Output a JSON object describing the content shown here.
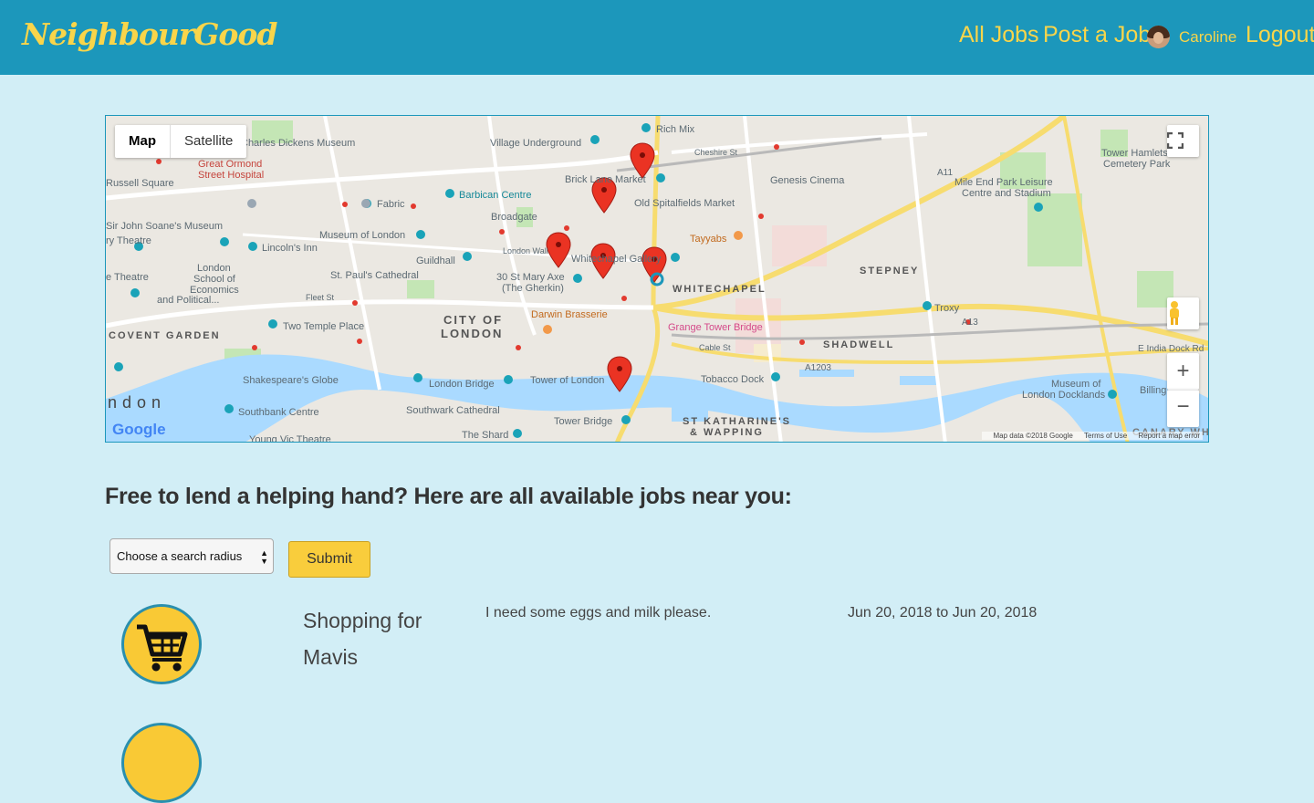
{
  "header": {
    "brand": "NeighbourGood",
    "nav": {
      "all_jobs": "All Jobs",
      "post_job": "Post a Job",
      "user": "Caroline",
      "logout": "Logout"
    }
  },
  "map": {
    "type_map": "Map",
    "type_satellite": "Satellite",
    "footer": {
      "data": "Map data ©2018 Google",
      "terms": "Terms of Use",
      "report": "Report a map error"
    },
    "google": "Google",
    "labels": {
      "l1": "Charles Dickens Museum",
      "l2": "Great Ormond",
      "l3": "Street Hospital",
      "l4": "Russell Square",
      "l5": "Fabric",
      "l6": "Barbican Centre",
      "l7": "Sir John Soane's Museum",
      "l8": "Museum of London",
      "l9": "Lincoln's Inn",
      "l10": "Guildhall",
      "l11": "London",
      "l12": "School of",
      "l13": "Economics",
      "l14": "and Political...",
      "l15": "St. Paul's Cathedral",
      "l16": "Two Temple Place",
      "l17": "CITY OF",
      "l18": "LONDON",
      "l19": "COVENT GARDEN",
      "l20": "Shakespeare's Globe",
      "l21": "London Bridge",
      "l22": "Southbank Centre",
      "l23": "Southwark Cathedral",
      "l24": "The Shard",
      "l25": "Tower of London",
      "l26": "Tower Bridge",
      "l27": "Darwin Brasserie",
      "l28": "30 St Mary Axe",
      "l29": "(The Gherkin)",
      "l30": "Broadgate",
      "l31": "Village Underground",
      "l32": "Rich Mix",
      "l33": "Brick Lane Market",
      "l34": "Old Spitalfields Market",
      "l35": "Genesis Cinema",
      "l36": "Tayyabs",
      "l37": "Whitechapel Gallery",
      "l38": "WHITECHAPEL",
      "l39": "Grange Tower Bridge",
      "l40": "STEPNEY",
      "l41": "Troxy",
      "l42": "SHADWELL",
      "l43": "Tobacco Dock",
      "l44": "ST KATHARINE'S",
      "l45": "& WAPPING",
      "l46": "Tower Hamlets",
      "l47": "Cemetery Park",
      "l48": "Mile End Park Leisure",
      "l49": "Centre and Stadium",
      "l50": "Museum of",
      "l51": "London Docklands",
      "l52": "Young Vic Theatre",
      "l53": "ndon",
      "l54": "ry Theatre",
      "l55": "e Theatre",
      "l56": "E India Dock Rd",
      "l57": "A13",
      "l58": "A11",
      "l59": "A1203",
      "l60": "Cable St",
      "l61": "Cheshire St",
      "l62": "London Wall",
      "l63": "Fleet St",
      "l64": "Billing",
      "l65": "CANARY WHARF"
    }
  },
  "content": {
    "heading": "Free to lend a helping hand? Here are all available jobs near you:",
    "radius_placeholder": "Choose a search radius",
    "submit": "Submit"
  },
  "jobs": [
    {
      "title": "Shopping for Mavis",
      "description": "I need some eggs and milk please.",
      "dates": "Jun 20, 2018 to Jun 20, 2018",
      "icon": "shopping-cart-icon"
    }
  ],
  "colors": {
    "header": "#1c97bb",
    "accent": "#f9d54a",
    "background": "#d2eef6",
    "button": "#f9cd3c"
  }
}
